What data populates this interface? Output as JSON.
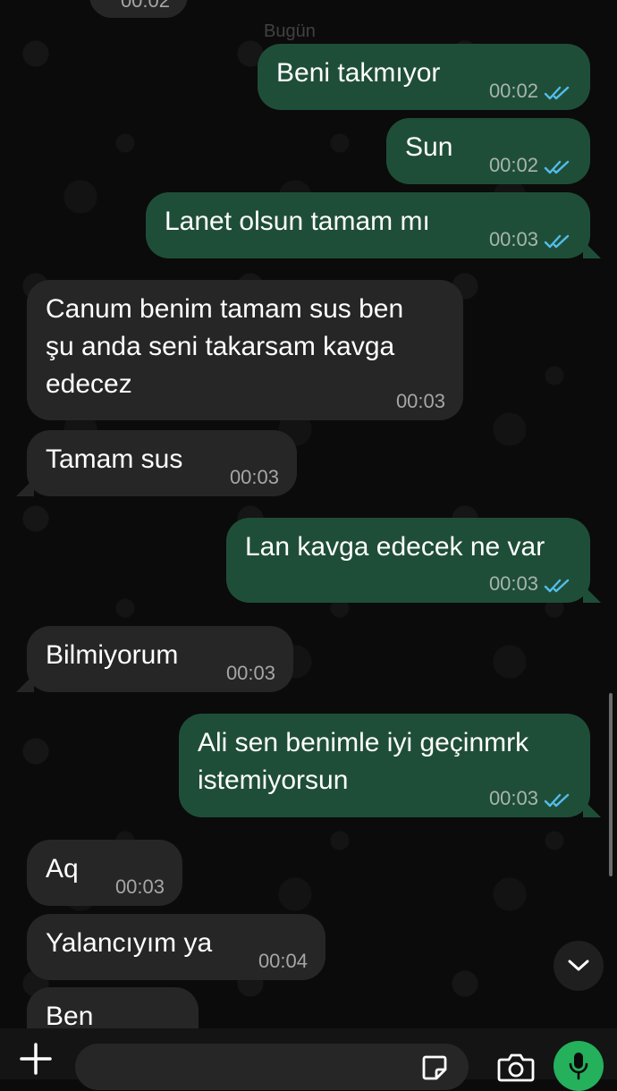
{
  "date_chip": "Bugün",
  "top_partial_time": "00:02",
  "messages": [
    {
      "dir": "out",
      "text": "Beni takmıyor",
      "time": "00:02",
      "read": true
    },
    {
      "dir": "out",
      "text": "Sun",
      "time": "00:02",
      "read": true
    },
    {
      "dir": "out",
      "text": "Lanet olsun tamam mı",
      "time": "00:03",
      "read": true
    },
    {
      "dir": "in",
      "text": "Canum benim tamam sus ben\nşu anda seni takarsam kavga\nedecez",
      "time": "00:03"
    },
    {
      "dir": "in",
      "text": "Tamam sus",
      "time": "00:03"
    },
    {
      "dir": "out",
      "text": "Lan kavga edecek ne var",
      "time": "00:03",
      "read": true
    },
    {
      "dir": "in",
      "text": "Bilmiyorum",
      "time": "00:03"
    },
    {
      "dir": "out",
      "text": "Ali sen benimle iyi geçinmrk\nistemiyorsun",
      "time": "00:03",
      "read": true
    },
    {
      "dir": "in",
      "text": "Aq",
      "time": "00:03"
    },
    {
      "dir": "in",
      "text": "Yalancıyım ya",
      "time": "00:04"
    },
    {
      "dir": "in",
      "text": "Ben",
      "time": ""
    }
  ],
  "colors": {
    "outgoing_bubble": "#1f4e38",
    "incoming_bubble": "#262626",
    "read_ticks": "#53bdeb",
    "mic_button": "#25b05c",
    "background": "#0b0b0b"
  },
  "icons": {
    "attach": "plus-icon",
    "sticker": "sticker-icon",
    "camera": "camera-icon",
    "mic": "microphone-icon",
    "scroll_down": "chevron-down-icon",
    "read_receipt": "double-check-icon"
  },
  "input": {
    "placeholder": "",
    "value": ""
  }
}
